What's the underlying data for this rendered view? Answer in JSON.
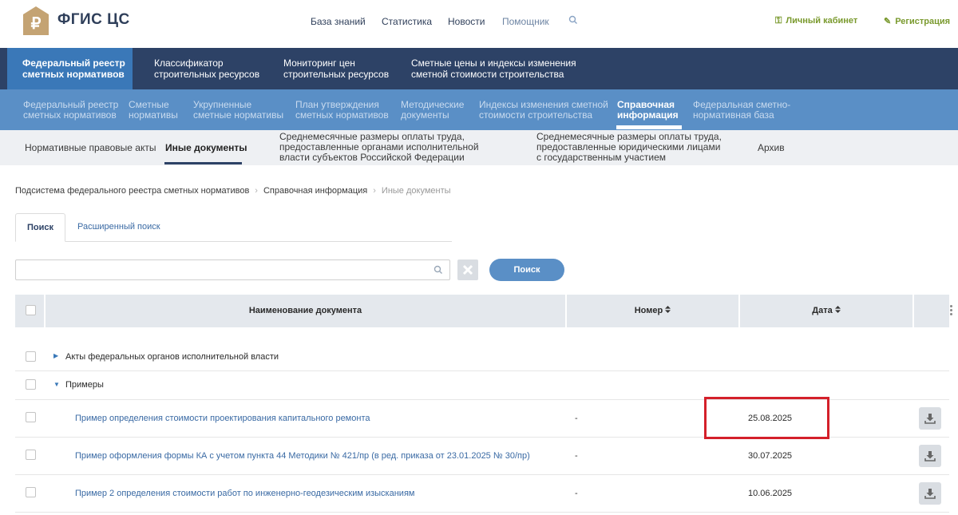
{
  "header": {
    "logo_text": "ФГИС ЦС",
    "nav": [
      "База знаний",
      "Статистика",
      "Новости",
      "Помощник"
    ],
    "cabinet_label": "Личный кабинет",
    "register_label": "Регистрация"
  },
  "main_nav": [
    {
      "line1": "Федеральный реестр",
      "line2": "сметных нормативов"
    },
    {
      "line1": "Классификатор",
      "line2": "строительных ресурсов"
    },
    {
      "line1": "Мониторинг цен",
      "line2": "строительных ресурсов"
    },
    {
      "line1": "Сметные цены и индексы изменения",
      "line2": "сметной стоимости строительства"
    }
  ],
  "sub_nav": [
    {
      "line1": "Федеральный реестр",
      "line2": "сметных нормативов"
    },
    {
      "line1": "Сметные",
      "line2": "нормативы"
    },
    {
      "line1": "Укрупненные",
      "line2": "сметные нормативы"
    },
    {
      "line1": "План утверждения",
      "line2": "сметных нормативов"
    },
    {
      "line1": "Методические",
      "line2": "документы"
    },
    {
      "line1": "Индексы изменения сметной",
      "line2": "стоимости строительства"
    },
    {
      "line1": "Справочная",
      "line2": "информация"
    },
    {
      "line1": "Федеральная сметно-",
      "line2": "нормативная база"
    }
  ],
  "tab_nav": {
    "items": [
      "Нормативные правовые акты",
      "Иные документы",
      "Архив"
    ],
    "multi": [
      {
        "line1": "Среднемесячные размеры оплаты труда,",
        "line2": "предоставленные органами исполнительной",
        "line3": "власти субъектов Российской Федерации"
      },
      {
        "line1": "Среднемесячные размеры оплаты труда,",
        "line2": "предоставленные юридическими лицами",
        "line3": "с государственным участием"
      }
    ]
  },
  "breadcrumb": {
    "items": [
      "Подсистема федерального реестра сметных нормативов",
      "Справочная информация",
      "Иные документы"
    ]
  },
  "search": {
    "tab_simple": "Поиск",
    "tab_advanced": "Расширенный поиск",
    "value": "",
    "button": "Поиск"
  },
  "table": {
    "columns": {
      "name": "Наименование документа",
      "number": "Номер",
      "date": "Дата"
    },
    "groups": [
      {
        "label": "Акты федеральных органов исполнительной власти",
        "expanded": false
      },
      {
        "label": "Примеры",
        "expanded": true
      }
    ],
    "rows": [
      {
        "name": "Пример определения стоимости проектирования капитального ремонта",
        "number": "-",
        "date": "25.08.2025"
      },
      {
        "name": "Пример оформления формы КА с учетом пункта 44 Методики № 421/пр (в ред. приказа от 23.01.2025 № 30/пр)",
        "number": "-",
        "date": "30.07.2025"
      },
      {
        "name": "Пример 2 определения стоимости работ по инженерно-геодезическим изысканиям",
        "number": "-",
        "date": "10.06.2025"
      }
    ]
  },
  "colors": {
    "dark_nav": "#2d4266",
    "active_blue": "#3a78b8",
    "sub_nav": "#5a8fc6",
    "accent_green": "#7a9a2e",
    "highlight": "#d4202a"
  }
}
